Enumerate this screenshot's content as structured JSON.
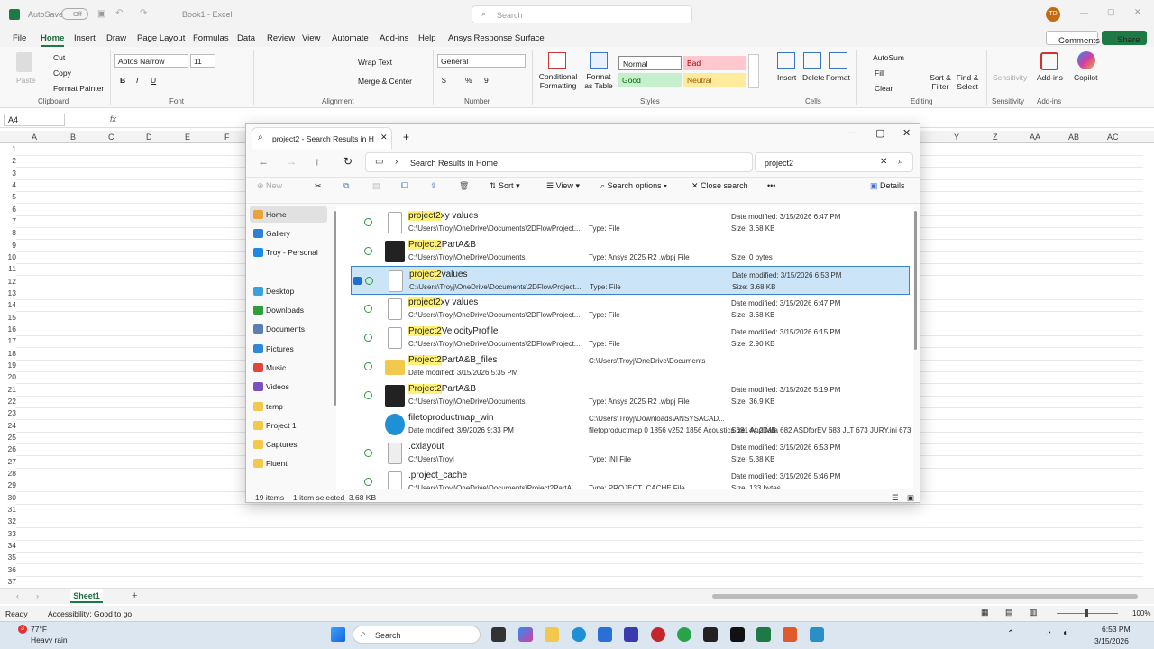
{
  "excel": {
    "autosave": "AutoSave",
    "autosave_state": "Off",
    "title": "Book1 - Excel",
    "search_placeholder": "Search",
    "user_initials": "TD",
    "menu": [
      "File",
      "Home",
      "Insert",
      "Draw",
      "Page Layout",
      "Formulas",
      "Data",
      "Review",
      "View",
      "Automate",
      "Add-ins",
      "Help",
      "Ansys Response Surface"
    ],
    "comments": "Comments",
    "share": "Share",
    "clipboard": {
      "paste": "Paste",
      "cut": "Cut",
      "copy": "Copy",
      "format_painter": "Format Painter",
      "label": "Clipboard"
    },
    "font": {
      "name": "Aptos Narrow",
      "size": "11",
      "label": "Font",
      "bold": "B",
      "italic": "I",
      "underline": "U"
    },
    "alignment": {
      "wrap": "Wrap Text",
      "merge": "Merge & Center",
      "label": "Alignment"
    },
    "number": {
      "format": "General",
      "label": "Number",
      "currency": "$",
      "percent": "%",
      "comma": "9"
    },
    "styles": {
      "cond": "Conditional Formatting",
      "table": "Format as Table",
      "normal": "Normal",
      "bad": "Bad",
      "good": "Good",
      "neutral": "Neutral",
      "label": "Styles"
    },
    "cells": {
      "insert": "Insert",
      "delete": "Delete",
      "format": "Format",
      "label": "Cells"
    },
    "editing": {
      "autosum": "AutoSum",
      "fill": "Fill",
      "clear": "Clear",
      "sort": "Sort & Filter",
      "find": "Find & Select",
      "label": "Editing"
    },
    "sensitivity": {
      "btn": "Sensitivity",
      "label": "Sensitivity"
    },
    "addins": {
      "btn": "Add-ins",
      "label": "Add-ins"
    },
    "copilot": "Copilot",
    "namebox": "A4",
    "fx": "fx",
    "columns": [
      "A",
      "B",
      "C",
      "D",
      "E",
      "F",
      "Y",
      "Z",
      "AA",
      "AB",
      "AC"
    ],
    "rows": [
      "1",
      "2",
      "3",
      "4",
      "5",
      "6",
      "7",
      "8",
      "9",
      "10",
      "11",
      "12",
      "13",
      "14",
      "15",
      "16",
      "17",
      "18",
      "19",
      "20",
      "21",
      "22",
      "23",
      "24",
      "25",
      "26",
      "27",
      "28",
      "29",
      "30",
      "31",
      "32",
      "33",
      "34",
      "35",
      "36",
      "37"
    ],
    "sheet_tab": "Sheet1",
    "status_ready": "Ready",
    "accessibility": "Accessibility: Good to go",
    "zoom": "100%"
  },
  "explorer": {
    "tab_title": "project2 - Search Results in H",
    "address": "Search Results in Home",
    "search_value": "project2",
    "commands": {
      "new": "New",
      "sort": "Sort",
      "view": "View",
      "search_options": "Search options",
      "close_search": "Close search",
      "details": "Details"
    },
    "nav": [
      {
        "label": "Home",
        "color": "#e8a33d"
      },
      {
        "label": "Gallery",
        "color": "#2f7fd6"
      },
      {
        "label": "Troy - Personal",
        "color": "#1e88e5"
      },
      {
        "label": "Desktop",
        "color": "#3aa0e0"
      },
      {
        "label": "Downloads",
        "color": "#2e9d3a"
      },
      {
        "label": "Documents",
        "color": "#5a7fb5"
      },
      {
        "label": "Pictures",
        "color": "#2f89d9"
      },
      {
        "label": "Music",
        "color": "#e0463c"
      },
      {
        "label": "Videos",
        "color": "#7a4fc4"
      },
      {
        "label": "temp",
        "color": "#f2c94c"
      },
      {
        "label": "Project 1",
        "color": "#f2c94c"
      },
      {
        "label": "Captures",
        "color": "#f2c94c"
      },
      {
        "label": "Fluent",
        "color": "#f2c94c"
      }
    ],
    "files": [
      {
        "hl": "project2",
        "rest": "xy values",
        "path": "C:\\Users\\Troyj\\OneDrive\\Documents\\2DFlowProject...",
        "type": "Type: File",
        "date": "Date modified: 3/15/2026 6:47 PM",
        "size": "Size: 3.68 KB",
        "icon": "doc"
      },
      {
        "hl": "Project2",
        "rest": "PartA&B",
        "path": "C:\\Users\\Troyj\\OneDrive\\Documents",
        "type": "Type: Ansys 2025 R2 .wbpj File",
        "date": "",
        "size": "Size: 0 bytes",
        "icon": "wb"
      },
      {
        "hl": "project2",
        "rest": "values",
        "path": "C:\\Users\\Troyj\\OneDrive\\Documents\\2DFlowProject...",
        "type": "Type: File",
        "date": "Date modified: 3/15/2026 6:53 PM",
        "size": "Size: 3.68 KB",
        "icon": "doc"
      },
      {
        "hl": "project2",
        "rest": "xy values",
        "path": "C:\\Users\\Troyj\\OneDrive\\Documents\\2DFlowProject...",
        "type": "Type: File",
        "date": "Date modified: 3/15/2026 6:47 PM",
        "size": "Size: 3.68 KB",
        "icon": "doc"
      },
      {
        "hl": "Project2",
        "rest": "VelocityProfile",
        "path": "C:\\Users\\Troyj\\OneDrive\\Documents\\2DFlowProject...",
        "type": "Type: File",
        "date": "Date modified: 3/15/2026 6:15 PM",
        "size": "Size: 2.90 KB",
        "icon": "doc"
      },
      {
        "hl": "Project2",
        "rest": "PartA&B_files",
        "path": "Date modified: 3/15/2026 5:35 PM",
        "type": "",
        "date": "",
        "size": "",
        "extra": "C:\\Users\\Troyj\\OneDrive\\Documents",
        "icon": "folder"
      },
      {
        "hl": "Project2",
        "rest": "PartA&B",
        "path": "C:\\Users\\Troyj\\OneDrive\\Documents",
        "type": "Type: Ansys 2025 R2 .wbpj File",
        "date": "Date modified: 3/15/2026 5:19 PM",
        "size": "Size: 36.9 KB",
        "icon": "wb"
      },
      {
        "hl": "",
        "rest": "filetoproductmap_win",
        "path": "Date modified: 3/9/2026 9:33 PM",
        "type": "",
        "date": "",
        "size": "Size: 44.2 MB",
        "extra": "C:\\Users\\Troyj\\Downloads\\ANSYSACAD...",
        "extra2": "filetoproductmap 0 1856 v252 1856 Acoustics 681 AppData 682 ASDforEV 683 JLT 673 JURY.ini 673 ...",
        "icon": "edge"
      },
      {
        "hl": "",
        "rest": ".cxlayout",
        "path": "C:\\Users\\Troyj",
        "type": "Type: INI File",
        "date": "Date modified: 3/15/2026 6:53 PM",
        "size": "Size: 5.38 KB",
        "icon": "ini"
      },
      {
        "hl": "",
        "rest": ".project_cache",
        "path": "C:\\Users\\Troyj\\OneDrive\\Documents\\Project2PartA...",
        "type": "Type: PROJECT_CACHE File",
        "date": "Date modified: 3/15/2026 5:46 PM",
        "size": "Size: 133 bytes",
        "icon": "doc"
      }
    ],
    "selected_index": 2,
    "status_items": "19 items",
    "status_selected": "1 item selected  3.68 KB"
  },
  "taskbar": {
    "weather_temp": "77°F",
    "weather_desc": "Heavy rain",
    "search": "Search",
    "time": "6:53 PM",
    "date": "3/15/2026",
    "badge": "3"
  }
}
